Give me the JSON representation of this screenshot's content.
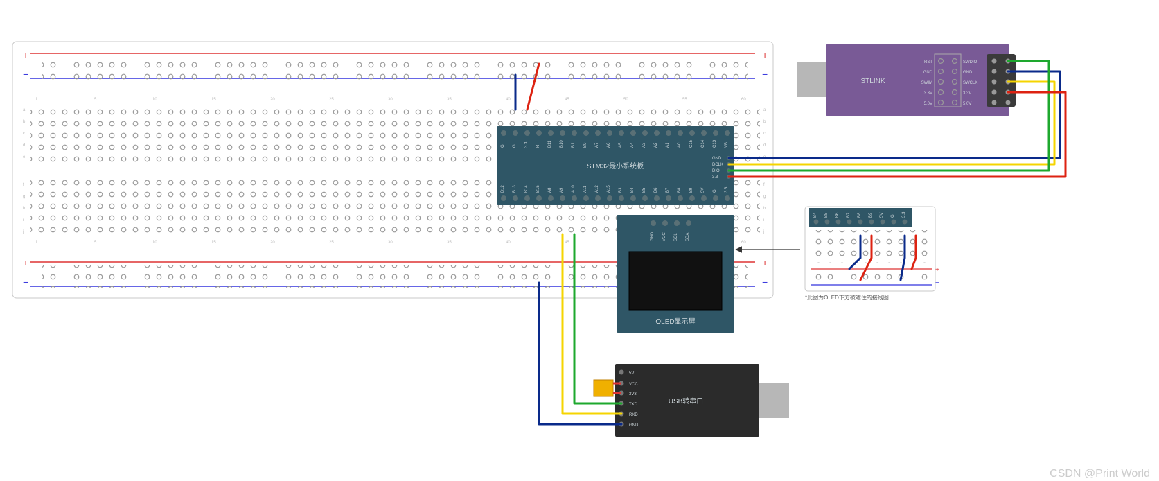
{
  "stm32": {
    "title": "STM32最小系统板",
    "top_pins": [
      "G",
      "G",
      "3.3",
      "R",
      "B11",
      "B10",
      "B1",
      "B0",
      "A7",
      "A6",
      "A5",
      "A4",
      "A3",
      "A2",
      "A1",
      "A0",
      "C15",
      "C14",
      "C13",
      "VB"
    ],
    "bottom_pins": [
      "B12",
      "B13",
      "B14",
      "B15",
      "A8",
      "A9",
      "A10",
      "A11",
      "A12",
      "A15",
      "B3",
      "B4",
      "B5",
      "B6",
      "B7",
      "B8",
      "B9",
      "5V",
      "G",
      "3.3"
    ],
    "right_pins": [
      "GND",
      "DCLK",
      "DIO",
      "3.3"
    ]
  },
  "oled": {
    "title": "OLED显示屏",
    "pins": [
      "GND",
      "VCC",
      "SCL",
      "SDA"
    ]
  },
  "stlink": {
    "title": "STLINK",
    "left_pins": [
      "RST",
      "GND",
      "SWIM",
      "3.3V",
      "5.0V"
    ],
    "right_pins": [
      "SWDIO",
      "GND",
      "SWCLK",
      "3.3V",
      "5.0V"
    ]
  },
  "usb_serial": {
    "title": "USB转串口",
    "pins": [
      "5V",
      "VCC",
      "3V3",
      "TXD",
      "RXD",
      "GND"
    ]
  },
  "detail": {
    "top_pins": [
      "B4",
      "B5",
      "B6",
      "B7",
      "B8",
      "B9",
      "5V",
      "G",
      "3.3"
    ],
    "caption": "*此图为OLED下方被遮住的接线图"
  },
  "watermark": "CSDN @Print World"
}
